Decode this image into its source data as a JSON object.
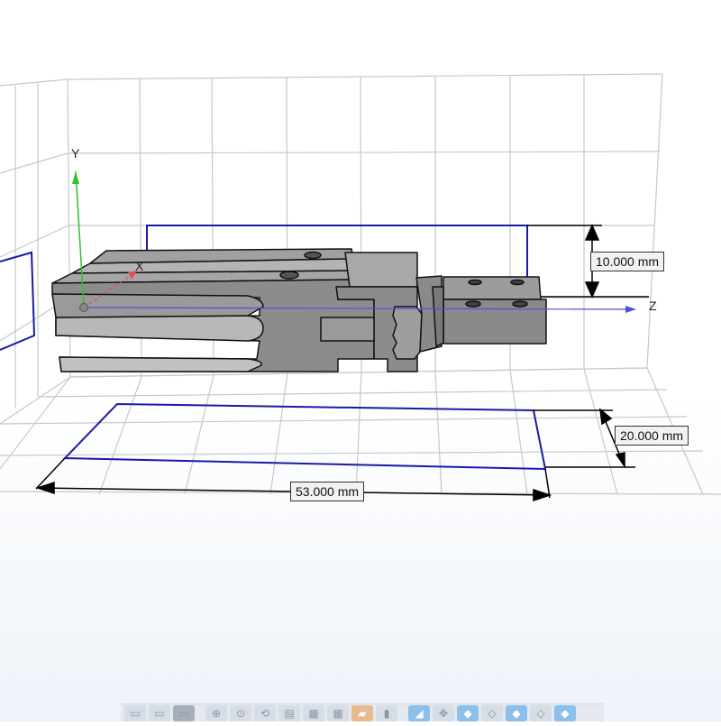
{
  "viewport": {
    "axes": {
      "x": "X",
      "y": "Y",
      "z": "Z"
    },
    "dimensions": {
      "height": "10.000 mm",
      "width": "20.000 mm",
      "length": "53.000 mm"
    },
    "colors": {
      "grid": "#c8c8c8",
      "bounding_box": "#1a1aa8",
      "part_fill": "#8a8a8a",
      "part_dark": "#6e6e6e",
      "x_axis": "#e05050",
      "y_axis": "#30c030",
      "z_axis": "#5050e0"
    }
  },
  "toolbar": {
    "buttons": [
      {
        "name": "view-box-icon"
      },
      {
        "name": "view-box-icon-2"
      },
      {
        "name": "view-box-icon-3"
      },
      {
        "name": "zoom-icon"
      },
      {
        "name": "zoom-fit-icon"
      },
      {
        "name": "rotate-icon"
      },
      {
        "name": "panel-icon"
      },
      {
        "name": "grid-icon"
      },
      {
        "name": "grid-2-icon"
      },
      {
        "name": "folder-icon"
      },
      {
        "name": "bar-chart-icon"
      },
      {
        "name": "shape-icon"
      },
      {
        "name": "move-icon"
      },
      {
        "name": "cube-icon"
      },
      {
        "name": "cube-2-icon"
      },
      {
        "name": "cube-3-icon"
      },
      {
        "name": "cube-4-icon"
      },
      {
        "name": "cube-5-icon"
      }
    ]
  }
}
